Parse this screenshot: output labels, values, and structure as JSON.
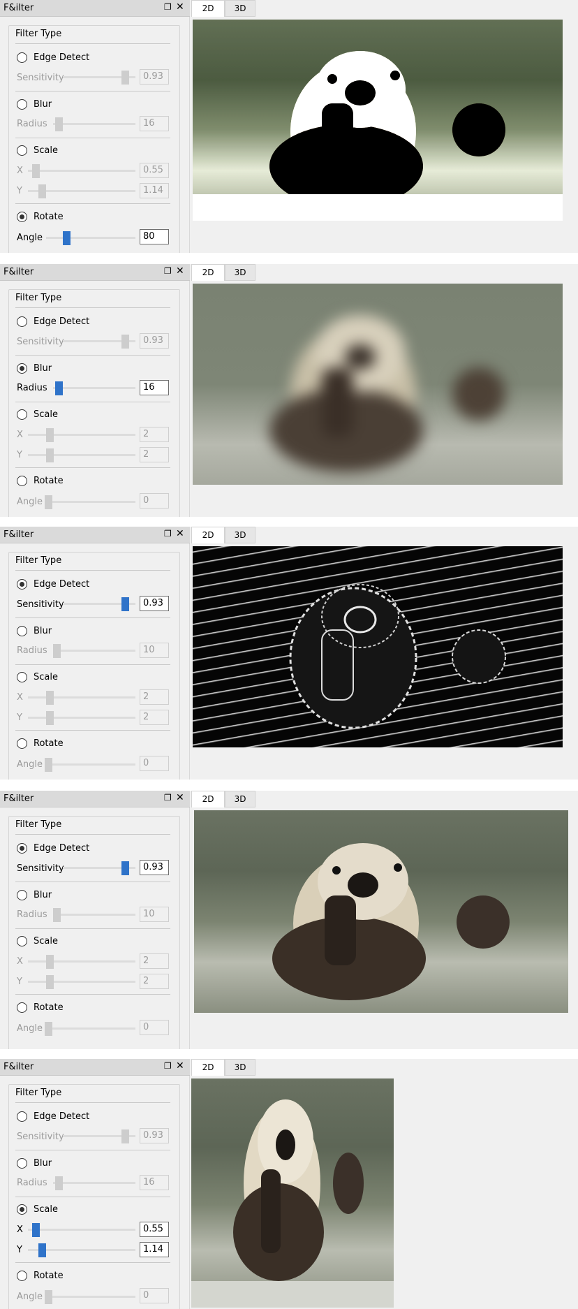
{
  "window": {
    "title": "F&ilter"
  },
  "tabs": [
    "2D",
    "3D"
  ],
  "filter_group": {
    "title": "Filter Type",
    "options": {
      "edge": "Edge Detect",
      "blur": "Blur",
      "scale": "Scale",
      "rotate": "Rotate"
    },
    "param_labels": {
      "sensitivity": "Sensitivity",
      "radius": "Radius",
      "x": "X",
      "y": "Y",
      "angle": "Angle"
    }
  },
  "panels": [
    {
      "selected": "Rotate",
      "active_tab": "2D",
      "values": {
        "sensitivity": "0.93",
        "radius": "16",
        "x": "0.55",
        "y": "1.14",
        "angle": "80"
      },
      "image_style": "high-contrast"
    },
    {
      "selected": "Blur",
      "active_tab": "2D",
      "values": {
        "sensitivity": "0.93",
        "radius": "16",
        "x": "2",
        "y": "2",
        "angle": "0"
      },
      "image_style": "blurred"
    },
    {
      "selected": "Edge Detect",
      "active_tab": "2D",
      "values": {
        "sensitivity": "0.93",
        "radius": "10",
        "x": "2",
        "y": "2",
        "angle": "0"
      },
      "image_style": "edge-detected"
    },
    {
      "selected": "Edge Detect",
      "active_tab": "2D",
      "values": {
        "sensitivity": "0.93",
        "radius": "10",
        "x": "2",
        "y": "2",
        "angle": "0"
      },
      "image_style": "normal"
    },
    {
      "selected": "Scale",
      "active_tab": "2D",
      "values": {
        "sensitivity": "0.93",
        "radius": "16",
        "x": "0.55",
        "y": "1.14",
        "angle": "0"
      },
      "image_style": "scaled"
    }
  ],
  "colors": {
    "accent": "#2f73c9",
    "window_bg": "#f0f0f0",
    "title_bg": "#dadada",
    "disabled_text": "#9b9b9b"
  }
}
